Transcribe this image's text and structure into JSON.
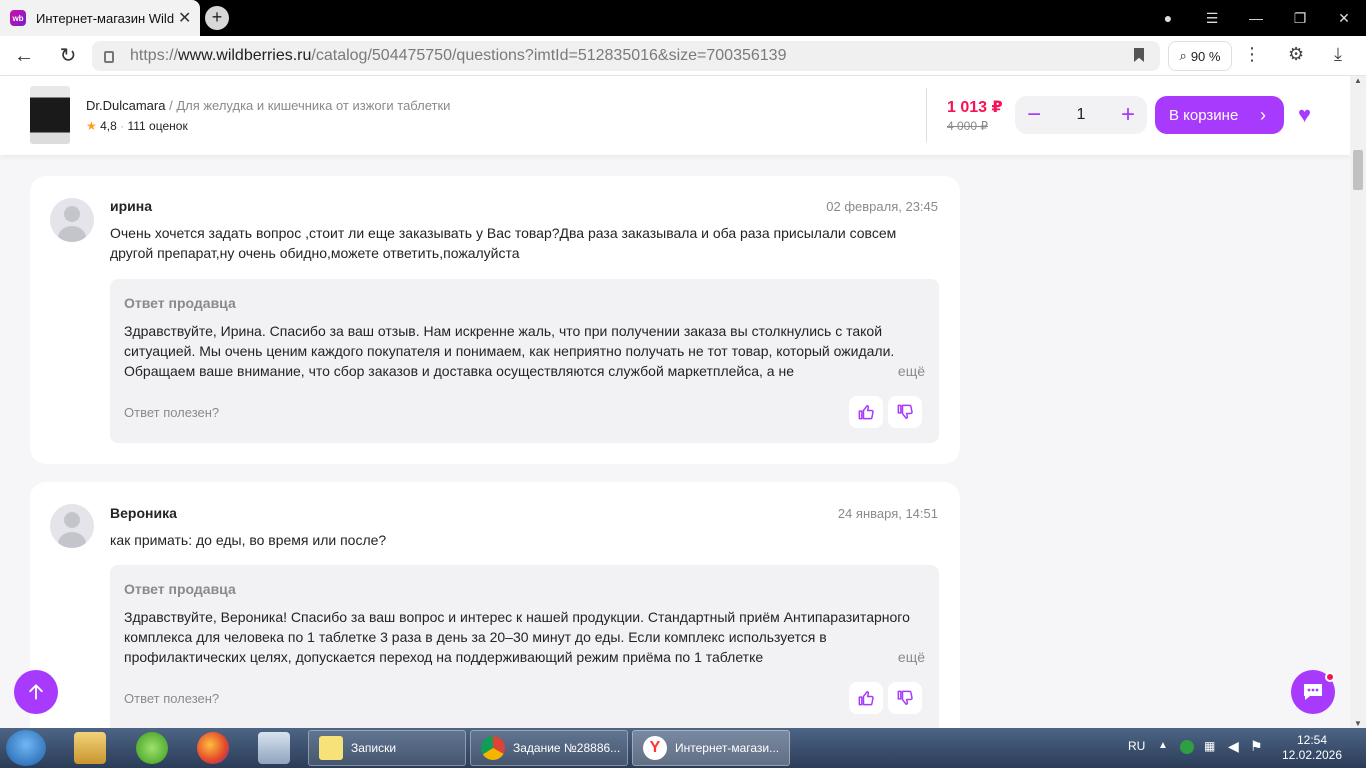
{
  "browser": {
    "tab_title": "Интернет-магазин Wildberries",
    "tab_fav": "wb",
    "new_tab": "+",
    "url_prefix": "https://",
    "url_domain": "www.wildberries.ru",
    "url_path": "/catalog/504475750/questions?imtId=512835016&size=700356139",
    "zoom": "90 %"
  },
  "product": {
    "brand": "Dr.Dulcamara",
    "separator": " / ",
    "name": "Для желудка и кишечника от изжоги таблетки",
    "rating": "4,8",
    "reviews": "111 оценок",
    "price": "1 013 ₽",
    "old_price": "4 000 ₽",
    "quantity": "1",
    "cart_label": "В корзине"
  },
  "questions": [
    {
      "author": "ирина",
      "date": "02 февраля, 23:45",
      "text": "Очень хочется задать вопрос ,стоит ли еще заказывать у Вас товар?Два раза заказывала и оба раза присылали совсем другой препарат,ну очень обидно,можете ответить,пожалуйста",
      "answer_title": "Ответ продавца",
      "answer_text": "Здравствуйте, Ирина. Спасибо за ваш отзыв. Нам искренне жаль, что при получении заказа вы столкнулись с такой ситуацией. Мы очень ценим каждого покупателя и понимаем, как неприятно получать не тот товар, который ожидали. Обращаем ваше внимание, что сбор заказов и доставка осуществляются службой маркетплейса, а не",
      "more": "ещё",
      "helpful": "Ответ полезен?"
    },
    {
      "author": "Вероника",
      "date": "24 января, 14:51",
      "text": "как примать: до еды, во время или после?",
      "answer_title": "Ответ продавца",
      "answer_text": "Здравствуйте, Вероника! Спасибо за ваш вопрос и интерес к нашей продукции. Стандартный приём Антипаразитарного комплекса для человека по 1 таблетке 3 раза в день за 20–30 минут до еды. Если комплекс используется в профилактических целях, допускается переход на поддерживающий режим приёма по 1 таблетке",
      "more": "ещё",
      "helpful": "Ответ полезен?"
    }
  ],
  "taskbar": {
    "tasks": [
      {
        "label": "Записки"
      },
      {
        "label": "Задание №28886..."
      },
      {
        "label": "Интернет-магази..."
      }
    ],
    "lang": "RU",
    "time": "12:54",
    "date": "12.02.2026"
  },
  "colors": {
    "accent": "#a73afd",
    "price": "#f91155"
  }
}
